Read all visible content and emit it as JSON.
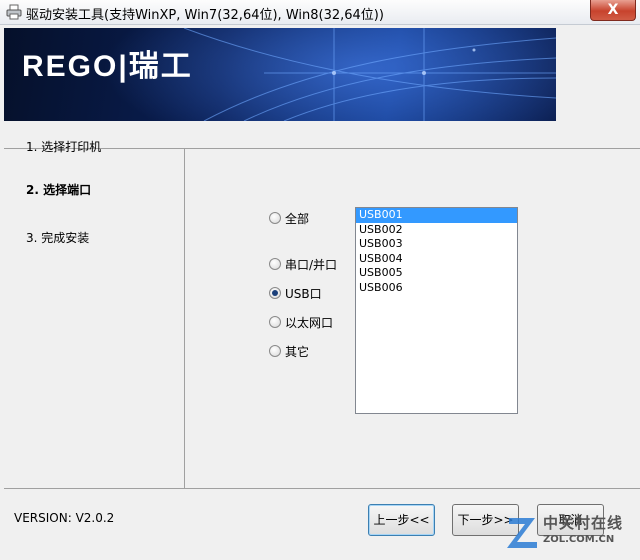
{
  "window": {
    "title": "驱动安装工具(支持WinXP, Win7(32,64位), Win8(32,64位))",
    "close_label": "X"
  },
  "banner": {
    "logo_text": "REGO|瑞工"
  },
  "steps": [
    {
      "label": "1. 选择打印机"
    },
    {
      "label": "2. 选择端口"
    },
    {
      "label": "3. 完成安装"
    }
  ],
  "port_options": {
    "all": {
      "label": "全部",
      "checked": false
    },
    "serial_parallel": {
      "label": "串口/并口",
      "checked": false
    },
    "usb": {
      "label": "USB口",
      "checked": true
    },
    "ethernet": {
      "label": "以太网口",
      "checked": false
    },
    "other": {
      "label": "其它",
      "checked": false
    }
  },
  "port_list": {
    "items": [
      "USB001",
      "USB002",
      "USB003",
      "USB004",
      "USB005",
      "USB006"
    ],
    "selected": "USB001"
  },
  "footer": {
    "version": "VERSION: V2.0.2",
    "prev_label": "上一步<<",
    "next_label": "下一步>>",
    "cancel_label": "取消"
  },
  "watermark": {
    "cn": "中关村在线",
    "en": "ZOL.COM.CN"
  },
  "colors": {
    "selection": "#3399ff",
    "banner_dark": "#0a1f55",
    "close_button": "#c7432d"
  }
}
